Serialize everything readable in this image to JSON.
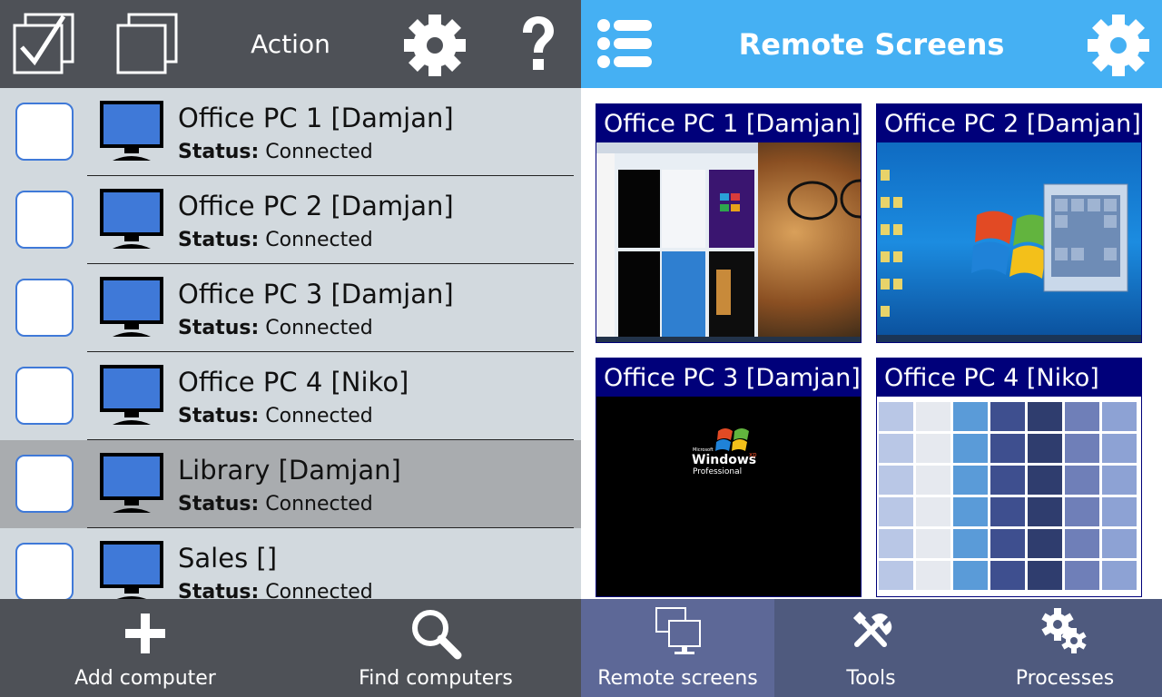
{
  "left": {
    "toolbar": {
      "select_all_icon": "checkbox-checked-icon",
      "select_none_icon": "checkbox-empty-icon",
      "action_label": "Action",
      "settings_icon": "gear-icon",
      "help_icon": "question-mark-icon"
    },
    "computers": [
      {
        "name": "Office PC 1 [Damjan]",
        "status_label": "Status:",
        "status": "Connected",
        "selected": false
      },
      {
        "name": "Office PC 2 [Damjan]",
        "status_label": "Status:",
        "status": "Connected",
        "selected": false
      },
      {
        "name": "Office PC 3 [Damjan]",
        "status_label": "Status:",
        "status": "Connected",
        "selected": false
      },
      {
        "name": "Office PC 4 [Niko]",
        "status_label": "Status:",
        "status": "Connected",
        "selected": false
      },
      {
        "name": "Library [Damjan]",
        "status_label": "Status:",
        "status": "Connected",
        "selected": true
      },
      {
        "name": "Sales []",
        "status_label": "Status:",
        "status": "Connected",
        "selected": false
      }
    ],
    "bottom": {
      "add_label": "Add computer",
      "find_label": "Find computers"
    }
  },
  "right": {
    "title": "Remote Screens",
    "menu_icon": "list-icon",
    "settings_icon": "gear-icon",
    "screens": [
      {
        "title": "Office PC 1 [Damjan]"
      },
      {
        "title": "Office PC 2 [Damjan]"
      },
      {
        "title": "Office PC 3 [Damjan]",
        "boot_logo": {
          "small": "Microsoft",
          "brand": "Windows",
          "version": "xp",
          "edition": "Professional"
        }
      },
      {
        "title": "Office PC 4 [Niko]"
      }
    ],
    "bottom": {
      "remote_label": "Remote screens",
      "tools_label": "Tools",
      "processes_label": "Processes"
    }
  },
  "colors": {
    "left_bar": "#4e5157",
    "list_bg": "#d2d9de",
    "selected_row": "#a9acaf",
    "right_header": "#45b0f3",
    "tile_title_bg": "#00007a",
    "right_bottom": "#4f5a7e",
    "checkbox_border": "#3f79d8",
    "monitor_blue": "#3f79d8"
  }
}
